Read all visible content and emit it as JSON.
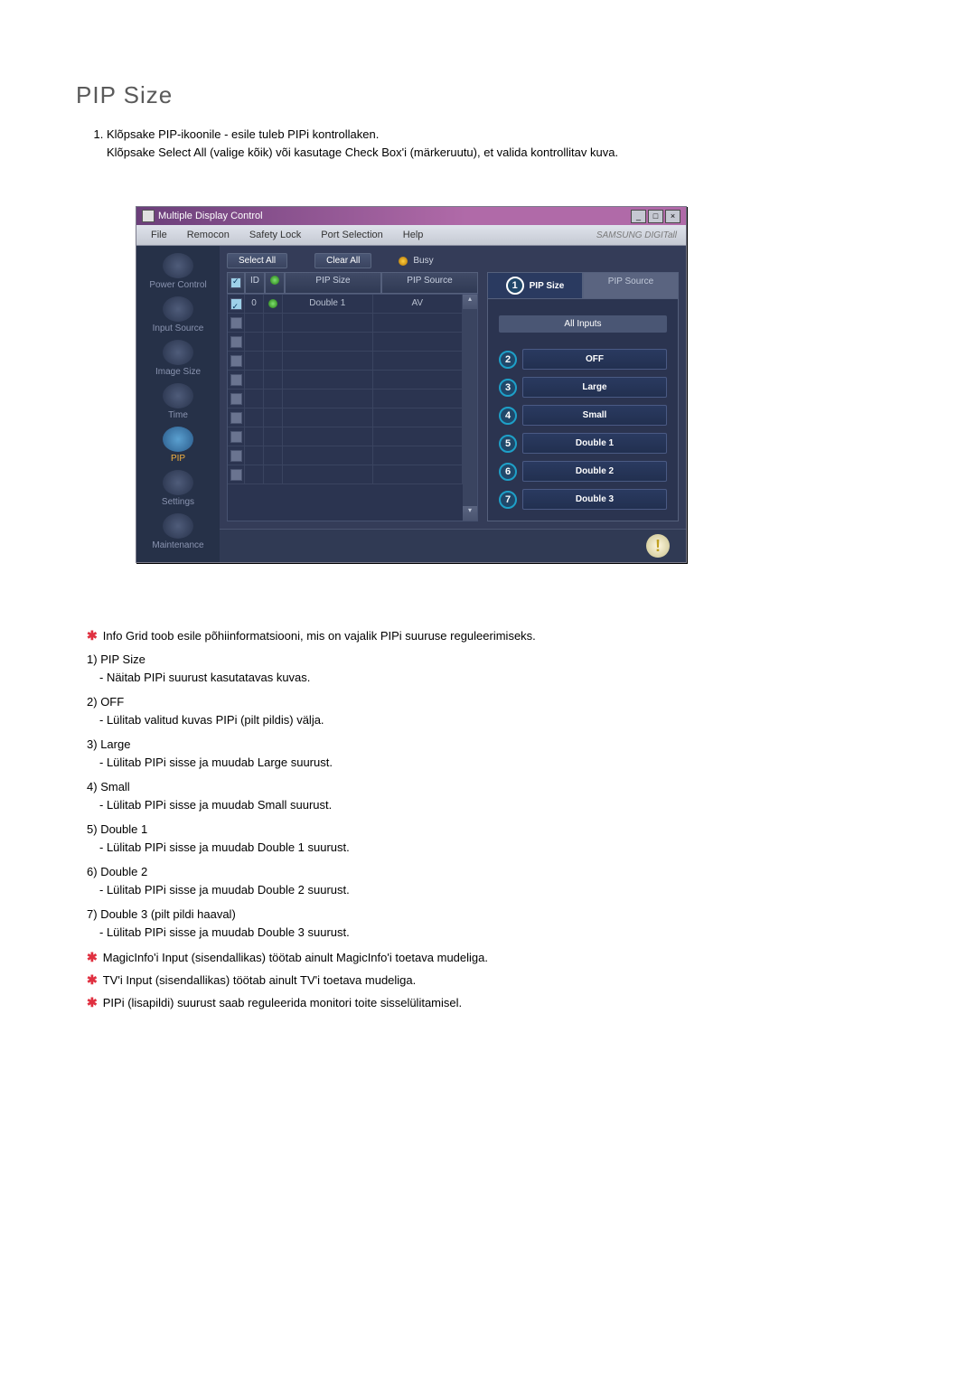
{
  "title": "PIP Size",
  "intro": {
    "line1": "Klõpsake PIP-ikoonile - esile tuleb PIPi kontrollaken.",
    "line2": "Klõpsake Select All (valige kõik) või kasutage Check Box'i (märkeruutu), et valida kontrollitav kuva."
  },
  "app": {
    "window_title": "Multiple Display Control",
    "menu": {
      "file": "File",
      "remocon": "Remocon",
      "safety": "Safety Lock",
      "port": "Port Selection",
      "help": "Help"
    },
    "brand": "SAMSUNG DIGITall",
    "sidebar": [
      {
        "label": "Power Control"
      },
      {
        "label": "Input Source"
      },
      {
        "label": "Image Size"
      },
      {
        "label": "Time"
      },
      {
        "label": "PIP",
        "active": true
      },
      {
        "label": "Settings"
      },
      {
        "label": "Maintenance"
      }
    ],
    "toolbar": {
      "select_all": "Select All",
      "clear_all": "Clear All",
      "busy": "Busy"
    },
    "grid": {
      "headers": {
        "id": "ID",
        "size": "PIP Size",
        "source": "PIP Source"
      },
      "first_row": {
        "id": "0",
        "size": "Double 1",
        "source": "AV"
      }
    },
    "panel": {
      "tab_size": "PIP Size",
      "tab_source": "PIP Source",
      "badge1": "1",
      "all_inputs": "All Inputs",
      "options": [
        {
          "num": "2",
          "label": "OFF"
        },
        {
          "num": "3",
          "label": "Large"
        },
        {
          "num": "4",
          "label": "Small"
        },
        {
          "num": "5",
          "label": "Double 1"
        },
        {
          "num": "6",
          "label": "Double 2"
        },
        {
          "num": "7",
          "label": "Double 3"
        }
      ]
    }
  },
  "desc": {
    "star_info": "Info Grid toob esile põhiinformatsiooni, mis on vajalik PIPi suuruse reguleerimiseks.",
    "items": [
      {
        "num": "1)",
        "name": "PIP Size",
        "sub": "- Näitab PIPi suurust kasutatavas kuvas."
      },
      {
        "num": "2)",
        "name": "OFF",
        "sub": "- Lülitab valitud kuvas PIPi (pilt pildis) välja."
      },
      {
        "num": "3)",
        "name": "Large",
        "sub": "- Lülitab PIPi sisse ja muudab Large suurust."
      },
      {
        "num": "4)",
        "name": "Small",
        "sub": "- Lülitab PIPi sisse ja muudab Small suurust."
      },
      {
        "num": "5)",
        "name": "Double 1",
        "sub": "- Lülitab PIPi sisse ja muudab Double 1 suurust."
      },
      {
        "num": "6)",
        "name": "Double 2",
        "sub": "- Lülitab PIPi sisse ja muudab Double 2 suurust."
      },
      {
        "num": "7)",
        "name": "Double 3 (pilt pildi haaval)",
        "sub": "- Lülitab PIPi sisse ja muudab Double 3 suurust."
      }
    ],
    "star_notes": [
      "MagicInfo'i Input (sisendallikas) töötab ainult MagicInfo'i toetava mudeliga.",
      "TV'i Input (sisendallikas) töötab ainult TV'i toetava mudeliga.",
      "PIPi (lisapildi) suurust saab reguleerida monitori toite sisselülitamisel."
    ]
  }
}
